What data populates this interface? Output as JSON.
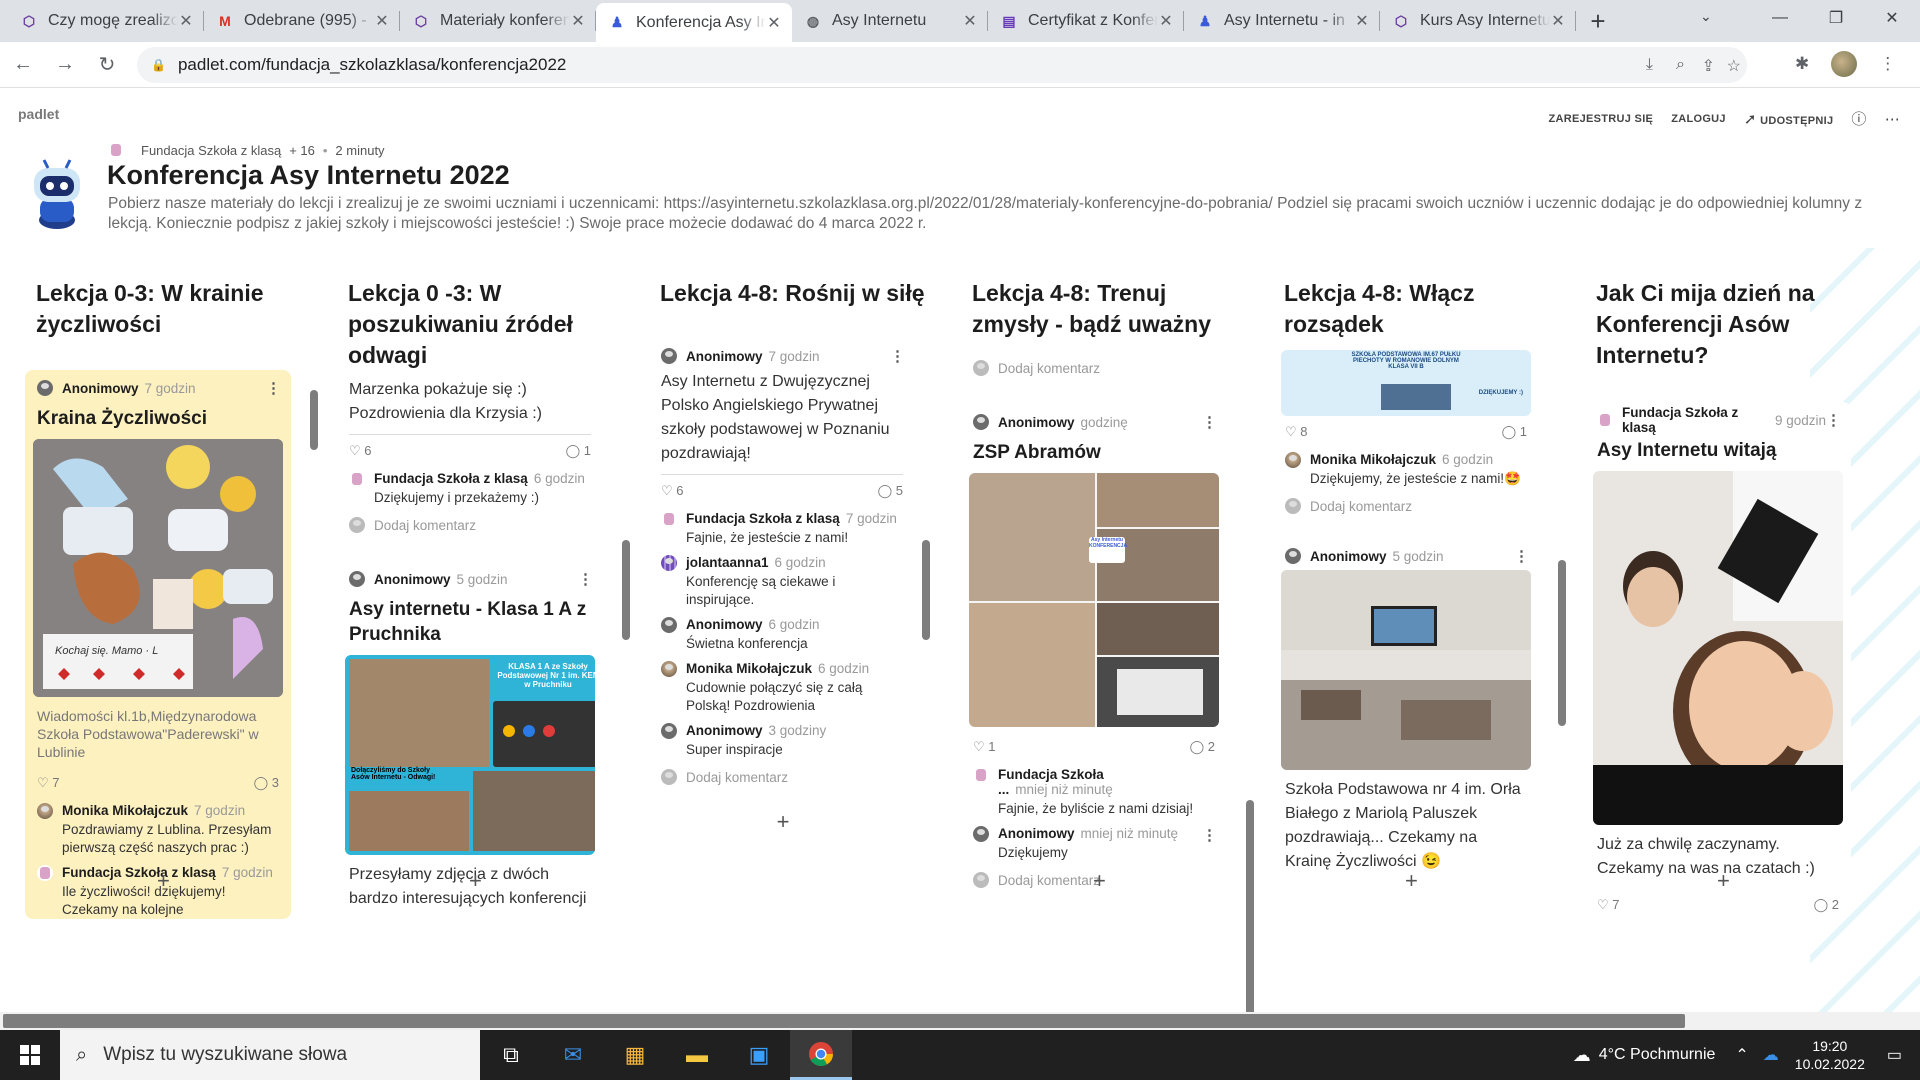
{
  "tabs": [
    {
      "title": "Czy mogę zrealizować",
      "icon": "padlet-icon"
    },
    {
      "title": "Odebrane (995) -",
      "icon": "gmail-icon"
    },
    {
      "title": "Materiały konferencyjne",
      "icon": "padlet-icon"
    },
    {
      "title": "Konferencja Asy Internetu",
      "icon": "asy-icon",
      "active": true
    },
    {
      "title": "Asy Internetu",
      "icon": "globe-icon"
    },
    {
      "title": "Certyfikat z Konferencji",
      "icon": "forms-icon"
    },
    {
      "title": "Asy Internetu - in",
      "icon": "asy-icon"
    },
    {
      "title": "Kurs Asy Internetu",
      "icon": "padlet-icon"
    }
  ],
  "browser": {
    "url": "padlet.com/fundacja_szkolazklasa/konferencja2022"
  },
  "padlet": {
    "logo": "padlet",
    "actions": {
      "register": "ZAREJESTRUJ SIĘ",
      "login": "ZALOGUJ",
      "share": "UDOSTĘPNIJ"
    },
    "meta_author": "Fundacja Szkoła z klasą",
    "meta_plus": "+ 16",
    "meta_time": "2 minuty",
    "title": "Konferencja Asy Internetu 2022",
    "description": "Pobierz nasze materiały do lekcji i zrealizuj je ze swoimi uczniami i uczennicami: https://asyinternetu.szkolazklasa.org.pl/2022/01/28/materialy-konferencyjne-do-pobrania/ Podziel się pracami swoich uczniów i uczennic dodając je do odpowiedniej kolumny z lekcją. Koniecznie podpisz z jakiej szkoły i miejscowości jesteście! :) Swoje prace możecie dodawać do 4 marca 2022 r."
  },
  "columns": [
    {
      "title": "Lekcja 0-3: W krainie życzliwości"
    },
    {
      "title": "Lekcja 0 -3: W poszukiwaniu źródeł odwagi"
    },
    {
      "title": "Lekcja 4-8: Rośnij w siłę"
    },
    {
      "title": "Lekcja 4-8: Trenuj zmysły - bądź uważny"
    },
    {
      "title": "Lekcja 4-8: Włącz rozsądek"
    },
    {
      "title": "Jak Ci mija dzień na Konferencji Asów Internetu?"
    }
  ],
  "col1": {
    "author": "Anonimowy",
    "ago": "7 godzin",
    "subject": "Kraina Życzliwości",
    "caption": "Wiadomości kl.1b,Międzynarodowa Szkoła Podstawowa\"Paderewski\" w Lublinie",
    "likes": "7",
    "comments": "3",
    "c1_author": "Monika Mikołajczuk",
    "c1_ago": "7 godzin",
    "c1_text": "Pozdrawiamy z Lublina. Przesyłam pierwszą część naszych prac :)",
    "c2_author": "Fundacja Szkoła z klasą",
    "c2_ago": "7 godzin",
    "c2_text": "Ile życzliwości! dziękujemy! Czekamy na kolejne"
  },
  "col2": {
    "top_text": "Marzenka pokażuje się :) Pozdrowienia dla Krzysia :)",
    "likes": "6",
    "comments": "1",
    "c1_author": "Fundacja Szkoła z klasą",
    "c1_ago": "6 godzin",
    "c1_text": "Dziękujemy i przekażemy :)",
    "add_comment": "Dodaj komentarz",
    "p2_author": "Anonimowy",
    "p2_ago": "5 godzin",
    "p2_subject": "Asy internetu - Klasa 1 A z Pruchnika",
    "p2_body": "Przesyłamy zdjęcia z dwóch bardzo interesujących konferencji"
  },
  "col3": {
    "author": "Anonimowy",
    "ago": "7 godzin",
    "body": "Asy Internetu z Dwujęzycznej Polsko Angielskiego Prywatnej szkoły podstawowej w Poznaniu pozdrawiają!",
    "likes": "6",
    "comments": "5",
    "c1_author": "Fundacja Szkoła z klasą",
    "c1_ago": "7 godzin",
    "c1_text": "Fajnie, że jesteście z nami!",
    "c2_author": "jolantaanna1",
    "c2_ago": "6 godzin",
    "c2_text": "Konferencję są ciekawe i inspirujące.",
    "c3_author": "Anonimowy",
    "c3_ago": "6 godzin",
    "c3_text": "Świetna konferencja",
    "c4_author": "Monika Mikołajczuk",
    "c4_ago": "6 godzin",
    "c4_text": "Cudownie połączyć się z całą Polską! Pozdrowienia",
    "c5_author": "Anonimowy",
    "c5_ago": "3 godziny",
    "c5_text": "Super inspiracje",
    "add_comment": "Dodaj komentarz"
  },
  "col4": {
    "add_comment_top": "Dodaj komentarz",
    "author": "Anonimowy",
    "ago": "godzinę",
    "subject": "ZSP Abramów",
    "likes": "1",
    "comments": "2",
    "c1_author": "Fundacja Szkoła ...",
    "c1_ago": "mniej niż minutę",
    "c1_text": "Fajnie, że byliście z nami dzisiaj!",
    "c2_author": "Anonimowy",
    "c2_ago": "mniej niż minutę",
    "c2_text": "Dziękujemy",
    "add_comment": "Dodaj komentarz"
  },
  "col5": {
    "likes": "8",
    "comments": "1",
    "c1_author": "Monika Mikołajczuk",
    "c1_ago": "6 godzin",
    "c1_text": "Dziękujemy, że jesteście z nami!🤩",
    "add_comment": "Dodaj komentarz",
    "p2_author": "Anonimowy",
    "p2_ago": "5 godzin",
    "p2_body": "Szkoła Podstawowa nr 4 im. Orła Białego z Mariolą Paluszek pozdrawiają... Czekamy na Krainę Życzliwości 😉",
    "banner_text": "SZKOŁA PODSTAWOWA IM.67 PUŁKU PIECHOTY W ROMANOWIE DOLNYM KLASA VII B",
    "banner_thanks": "DZIĘKUJEMY :)"
  },
  "col6": {
    "author": "Fundacja Szkoła z klasą",
    "ago": "9 godzin",
    "subject": "Asy Internetu witają",
    "body": "Już za chwilę zaczynamy. Czekamy na was na czatach :)",
    "likes": "7",
    "comments": "2"
  },
  "images": {
    "col2_banner": "KLASA 1 A ze Szkoły Podstawowej Nr 1 im. KEN w Pruchniku",
    "col2_sub": "Dołączyliśmy do Szkoły Asów Internetu - Odwagi!",
    "col4_logo": "Asy Internetu KONFERENCJA"
  },
  "taskbar": {
    "search_placeholder": "Wpisz tu wyszukiwane słowa",
    "weather": "4°C  Pochmurnie",
    "time": "19:20",
    "date": "10.02.2022"
  }
}
